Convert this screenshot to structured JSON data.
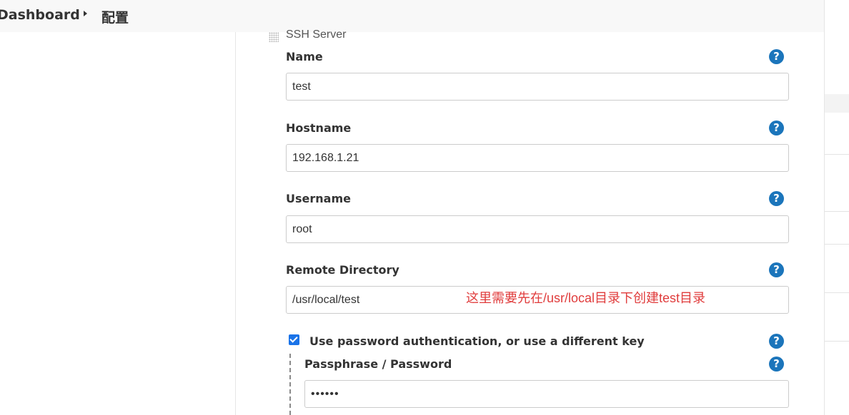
{
  "breadcrumb": {
    "items": [
      "Dashboard",
      "配置"
    ]
  },
  "section": {
    "title": "SSH Server"
  },
  "form": {
    "name": {
      "label": "Name",
      "value": "test"
    },
    "hostname": {
      "label": "Hostname",
      "value": "192.168.1.21"
    },
    "username": {
      "label": "Username",
      "value": "root"
    },
    "remote_directory": {
      "label": "Remote Directory",
      "value": "/usr/local/test"
    },
    "use_password_auth": {
      "label": "Use password authentication, or use a different key",
      "checked": true
    },
    "passphrase": {
      "label": "Passphrase / Password",
      "value": "••••••"
    }
  },
  "annotation": "这里需要先在/usr/local目录下创建test目录",
  "help_icon_glyph": "?",
  "colors": {
    "help_icon": "#1b75bb",
    "annotation": "#e03c3c",
    "checkbox": "#1a73e8"
  }
}
